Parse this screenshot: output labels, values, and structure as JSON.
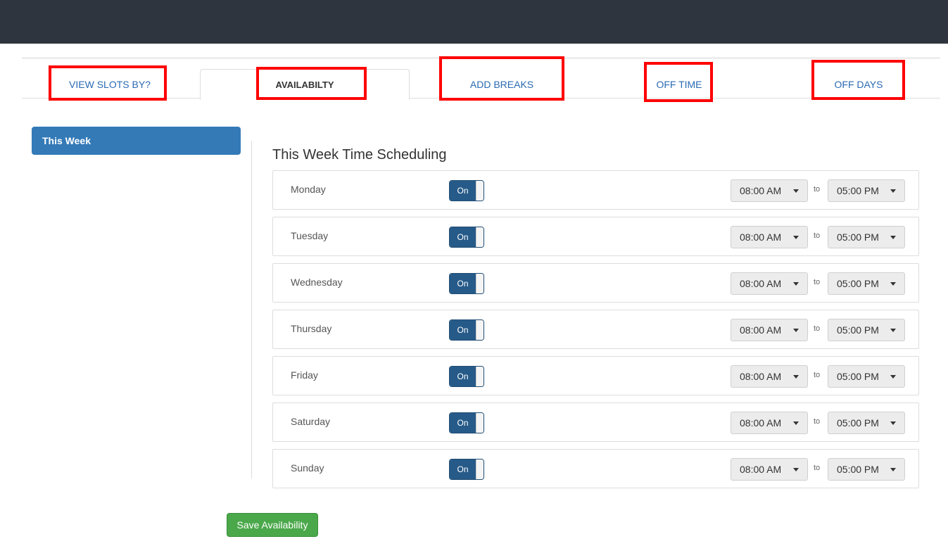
{
  "tabs": [
    {
      "label": "VIEW SLOTS BY?"
    },
    {
      "label": "AVAILABILTY"
    },
    {
      "label": "ADD BREAKS"
    },
    {
      "label": "OFF TIME"
    },
    {
      "label": "OFF DAYS"
    }
  ],
  "active_tab": "AVAILABILTY",
  "sidebar": {
    "items": [
      {
        "label": "This Week"
      }
    ]
  },
  "schedule": {
    "title": "This Week Time Scheduling",
    "to_label": "to",
    "days": [
      {
        "day": "Monday",
        "toggle": "On",
        "start": "08:00 AM",
        "end": "05:00 PM"
      },
      {
        "day": "Tuesday",
        "toggle": "On",
        "start": "08:00 AM",
        "end": "05:00 PM"
      },
      {
        "day": "Wednesday",
        "toggle": "On",
        "start": "08:00 AM",
        "end": "05:00 PM"
      },
      {
        "day": "Thursday",
        "toggle": "On",
        "start": "08:00 AM",
        "end": "05:00 PM"
      },
      {
        "day": "Friday",
        "toggle": "On",
        "start": "08:00 AM",
        "end": "05:00 PM"
      },
      {
        "day": "Saturday",
        "toggle": "On",
        "start": "08:00 AM",
        "end": "05:00 PM"
      },
      {
        "day": "Sunday",
        "toggle": "On",
        "start": "08:00 AM",
        "end": "05:00 PM"
      }
    ]
  },
  "save_button": {
    "label": "Save Availability"
  },
  "colors": {
    "topbar": "#2f353e",
    "accent": "#337ab7",
    "toggle_on": "#265a88",
    "highlight": "#ff0000",
    "save": "#4aa84a"
  }
}
